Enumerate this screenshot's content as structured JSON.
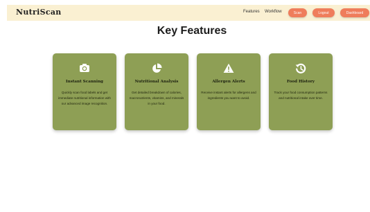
{
  "brand": "NutriScan",
  "nav": {
    "features": "Features",
    "workflow": "Workflow",
    "scan": "Scan",
    "logout": "Logout",
    "dashboard": "Dashboard"
  },
  "colors": {
    "navbar_bg": "#faf0d2",
    "accent": "#ef7d5b",
    "card_bg": "#8e9f55"
  },
  "section_title": "Key Features",
  "features": [
    {
      "icon": "camera-icon",
      "title": "Instant Scanning",
      "description": "Quickly scan food labels and get immediate nutritional information with our advanced image recognition."
    },
    {
      "icon": "pie-chart-icon",
      "title": "Nutritional Analysis",
      "description": "Get detailed breakdown of calories, macronutrients, vitamins, and minerals in your food."
    },
    {
      "icon": "warning-icon",
      "title": "Allergen Alerts",
      "description": "Receive instant alerts for allergens and ingredients you want to avoid."
    },
    {
      "icon": "history-icon",
      "title": "Food History",
      "description": "Track your food consumption patterns and nutritional intake over time."
    }
  ]
}
